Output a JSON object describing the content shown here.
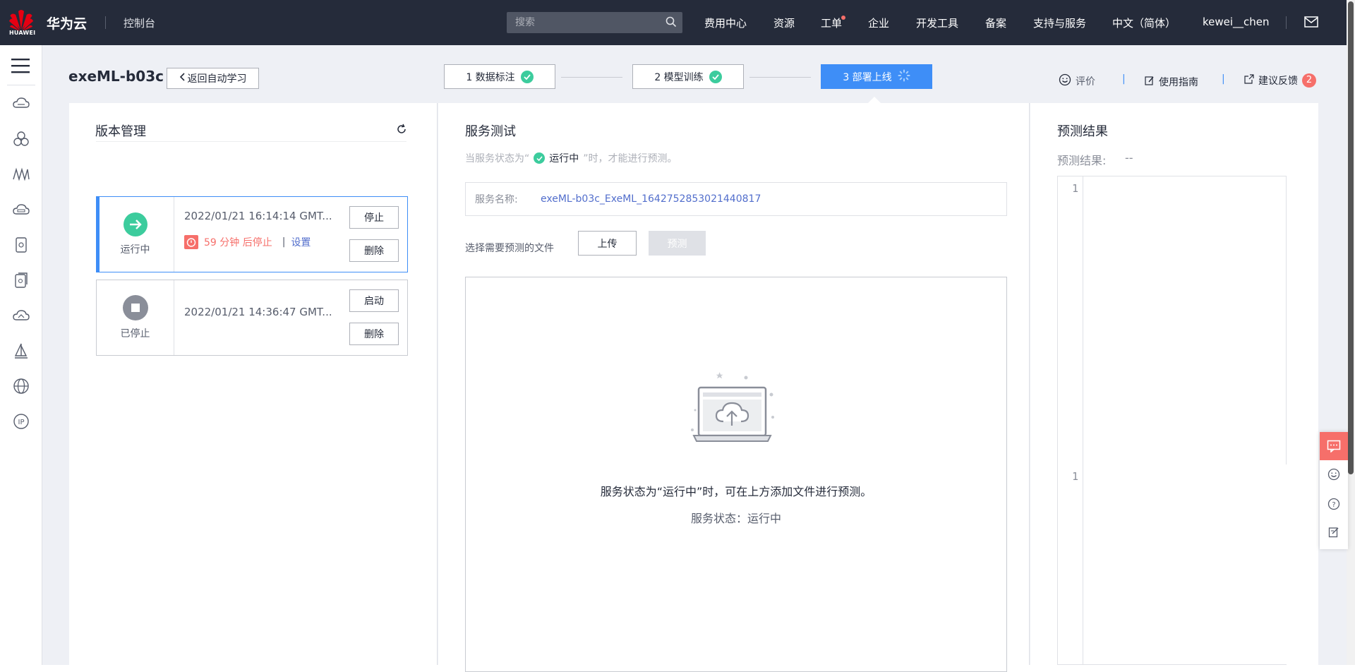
{
  "topbar": {
    "logo_text": "HUAWEI",
    "brand": "华为云",
    "console": "控制台",
    "search_placeholder": "搜索",
    "nav": [
      "费用中心",
      "资源",
      "工单",
      "企业",
      "开发工具",
      "备案",
      "支持与服务",
      "中文（简体）",
      "kewei__chen"
    ]
  },
  "header": {
    "project_title": "exeML-b03c",
    "back_label": "返回自动学习",
    "steps": [
      {
        "label": "1 数据标注",
        "state": "done"
      },
      {
        "label": "2 模型训练",
        "state": "done"
      },
      {
        "label": "3 部署上线",
        "state": "active"
      }
    ],
    "links": {
      "rate": "评价",
      "guide": "使用指南",
      "feedback": "建议反馈",
      "feedback_count": "2"
    }
  },
  "versions": {
    "title": "版本管理",
    "items": [
      {
        "status": "运行中",
        "time": "2022/01/21 16:14:14 GMT...",
        "countdown": "59 分钟 后停止",
        "setting": "设置",
        "btn1": "停止",
        "btn2": "删除"
      },
      {
        "status": "已停止",
        "time": "2022/01/21 14:36:47 GMT...",
        "btn1": "启动",
        "btn2": "删除"
      }
    ]
  },
  "service_test": {
    "title": "服务测试",
    "hint_prefix": "当服务状态为“",
    "hint_status": "运行中",
    "hint_suffix": "”时，才能进行预测。",
    "name_label": "服务名称:",
    "name_value": "exeML-b03c_ExeML_1642752853021440817",
    "file_label": "选择需要预测的文件",
    "upload": "上传",
    "predict": "预测",
    "drop_text": "服务状态为“运行中”时，可在上方添加文件进行预测。",
    "drop_status": "服务状态：运行中"
  },
  "prediction": {
    "title": "预测结果",
    "label": "预测结果:",
    "value": "--",
    "line1": "1",
    "line2": "1"
  },
  "colors": {
    "brand_dark": "#252b3a",
    "accent": "#3e8ef7",
    "success": "#3ccc9d",
    "danger": "#f66f6a"
  }
}
